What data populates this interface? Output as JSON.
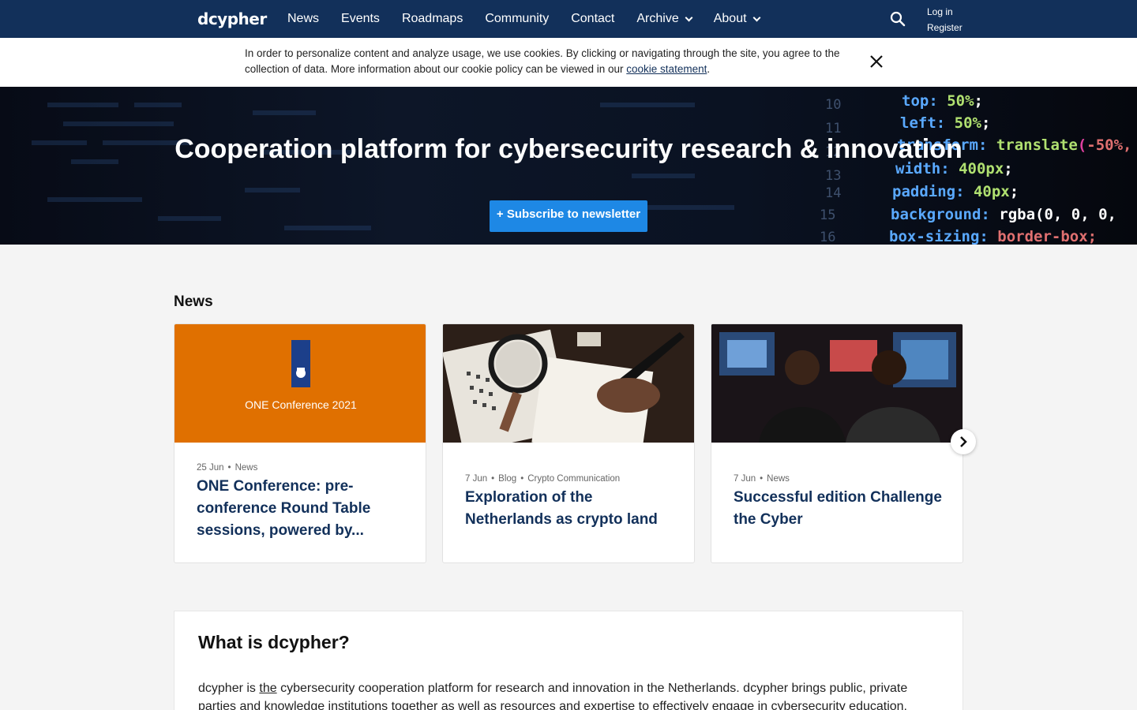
{
  "nav": {
    "logo": "dcypher",
    "links": [
      "News",
      "Events",
      "Roadmaps",
      "Community",
      "Contact"
    ],
    "dropdowns": [
      "Archive",
      "About"
    ],
    "login": "Log in",
    "register": "Register",
    "bg_color": "#12305a"
  },
  "cookie": {
    "text": "In order to personalize content and analyze usage, we use cookies. By clicking or navigating through the site, you agree to the collection of data. More information about our cookie policy can be viewed in our ",
    "link": "cookie statement",
    "end": "."
  },
  "hero": {
    "title": "Cooperation platform for cybersecurity research & innovation",
    "subscribe": "+ Subscribe to newsletter",
    "button_color": "#1e88e5"
  },
  "news": {
    "heading": "News",
    "cards": [
      {
        "date": "25 Jun",
        "tags": [
          "News"
        ],
        "title": "ONE Conference: pre-conference Round Table sessions, powered by...",
        "image_label": "ONE Conference 2021",
        "image_color": "#e07000"
      },
      {
        "date": "7 Jun",
        "tags": [
          "Blog",
          "Crypto Communication"
        ],
        "title": "Exploration of the Netherlands as crypto land"
      },
      {
        "date": "7 Jun",
        "tags": [
          "News"
        ],
        "title": "Successful edition Challenge the Cyber"
      }
    ]
  },
  "about": {
    "title": "What is dcypher?",
    "pre": "dcypher is ",
    "underlined": "the",
    "post": " cybersecurity cooperation platform for research and innovation in the Netherlands. dcypher brings public, private parties and knowledge institutions together as well as resources and expertise to effectively engage in cybersecurity education, research, innovation for"
  }
}
